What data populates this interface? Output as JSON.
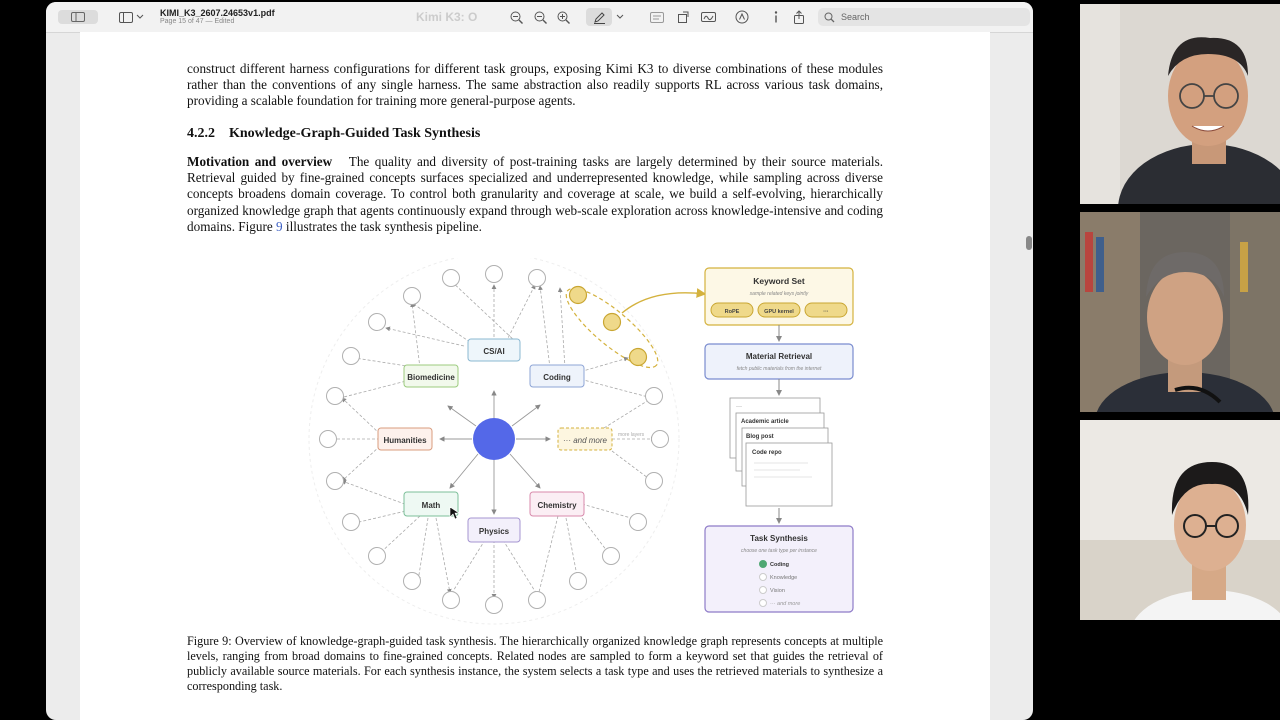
{
  "window": {
    "filename": "KIMI_K3_2607.24653v1.pdf",
    "page_status": "Page 15 of 47 — Edited",
    "ghost_title": "Kimi K3: O",
    "search_placeholder": "Search"
  },
  "document": {
    "para1": "construct different harness configurations for different task groups, exposing Kimi K3 to diverse combinations of these modules rather than the conventions of any single harness. The same abstraction also readily supports RL across various task domains, providing a scalable foundation for training more general-purpose agents.",
    "section_number": "4.2.2",
    "section_title": "Knowledge-Graph-Guided Task Synthesis",
    "para2_lead": "Motivation and overview",
    "para2_text": "The quality and diversity of post-training tasks are largely determined by their source materials. Retrieval guided by fine-grained concepts surfaces specialized and underrepresented knowledge, while sampling across diverse concepts broadens domain coverage. To control both granularity and coverage at scale, we build a self-evolving, hierarchically organized knowledge graph that agents continuously expand through web-scale exploration across knowledge-intensive and coding domains.",
    "para2_fig_prefix": "Figure",
    "para2_fig_num": "9",
    "para2_fig_suffix": "illustrates the task synthesis pipeline.",
    "caption": "Figure 9: Overview of knowledge-graph-guided task synthesis. The hierarchically organized knowledge graph represents concepts at multiple levels, ranging from broad domains to fine-grained concepts. Related nodes are sampled to form a keyword set that guides the retrieval of publicly available source materials. For each synthesis instance, the system selects a task type and uses the retrieved materials to synthesize a corresponding task."
  },
  "figure": {
    "domains": {
      "csai": "CS/AI",
      "coding": "Coding",
      "biomedicine": "Biomedicine",
      "humanities": "Humanities",
      "math": "Math",
      "physics": "Physics",
      "chemistry": "Chemistry",
      "more": "··· and more",
      "more_note": "more layers"
    },
    "keyword_set": {
      "title": "Keyword Set",
      "subtitle": "sample related keys jointly",
      "chips": [
        "RoPE",
        "GPU kernel",
        "···"
      ]
    },
    "material_retrieval": {
      "title": "Material Retrieval",
      "subtitle": "fetch public materials from the internet"
    },
    "materials": {
      "top": "···",
      "academic": "Academic article",
      "blog": "Blog post",
      "repo": "Code repo"
    },
    "task_synthesis": {
      "title": "Task Synthesis",
      "subtitle": "choose one task type per instance",
      "options": [
        "Coding",
        "Knowledge",
        "Vision",
        "··· and more"
      ],
      "selected": "Coding"
    },
    "colors": {
      "center": "#5468e8",
      "highlight": "#efd98a",
      "accent_gold": "#d4b23e",
      "retrieval_blue": "#7a8ccf",
      "synthesis_purple": "#8e7bc8"
    }
  }
}
